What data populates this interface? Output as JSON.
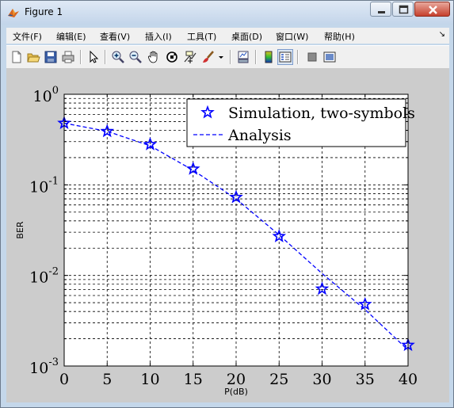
{
  "window": {
    "title": "Figure 1"
  },
  "menu": [
    {
      "id": "file",
      "label": "文件(F)"
    },
    {
      "id": "edit",
      "label": "编辑(E)"
    },
    {
      "id": "view",
      "label": "查看(V)"
    },
    {
      "id": "insert",
      "label": "插入(I)"
    },
    {
      "id": "tools",
      "label": "工具(T)"
    },
    {
      "id": "desktop",
      "label": "桌面(D)"
    },
    {
      "id": "window",
      "label": "窗口(W)"
    },
    {
      "id": "help",
      "label": "帮助(H)"
    }
  ],
  "menu_arrow": "↘",
  "toolbar": [
    {
      "icon": "new-figure-icon"
    },
    {
      "icon": "open-file-icon"
    },
    {
      "icon": "save-icon"
    },
    {
      "icon": "print-icon"
    },
    {
      "icon": "edit-plot-arrow-icon"
    },
    {
      "icon": "zoom-in-icon"
    },
    {
      "icon": "zoom-out-icon"
    },
    {
      "icon": "pan-hand-icon"
    },
    {
      "icon": "rotate-3d-icon"
    },
    {
      "icon": "data-cursor-icon"
    },
    {
      "icon": "brush-icon"
    },
    {
      "icon": "link-plot-icon"
    },
    {
      "icon": "colorbar-icon"
    },
    {
      "icon": "legend-icon"
    },
    {
      "icon": "hide-plot-tools-icon"
    },
    {
      "icon": "show-plot-tools-icon"
    }
  ],
  "chart_data": {
    "type": "line",
    "title": "",
    "xlabel": "P(dB)",
    "ylabel": "BER",
    "xlim": [
      0,
      40
    ],
    "ylim": [
      0.001,
      1
    ],
    "yscale": "log",
    "grid": true,
    "x_ticks": [
      "0",
      "5",
      "10",
      "15",
      "20",
      "25",
      "30",
      "35",
      "40"
    ],
    "y_ticks": [
      {
        "base": "10",
        "exp": "-3"
      },
      {
        "base": "10",
        "exp": "-2"
      },
      {
        "base": "10",
        "exp": "-1"
      },
      {
        "base": "10",
        "exp": "0"
      }
    ],
    "legend_position": "top-right",
    "series": [
      {
        "name": "Simulation, two-symbols",
        "style": "markers",
        "marker": "pentagram",
        "color": "#0000ff",
        "x": [
          0,
          5,
          10,
          15,
          20,
          25,
          30,
          35,
          40
        ],
        "y": [
          0.48,
          0.39,
          0.28,
          0.15,
          0.073,
          0.027,
          0.0071,
          0.0048,
          0.0017
        ]
      },
      {
        "name": "Analysis",
        "style": "dashed",
        "color": "#0000ff",
        "x": [
          0,
          5,
          10,
          15,
          20,
          25,
          30,
          35,
          40
        ],
        "y": [
          0.48,
          0.39,
          0.27,
          0.145,
          0.07,
          0.028,
          0.0105,
          0.0042,
          0.0015
        ]
      }
    ]
  }
}
